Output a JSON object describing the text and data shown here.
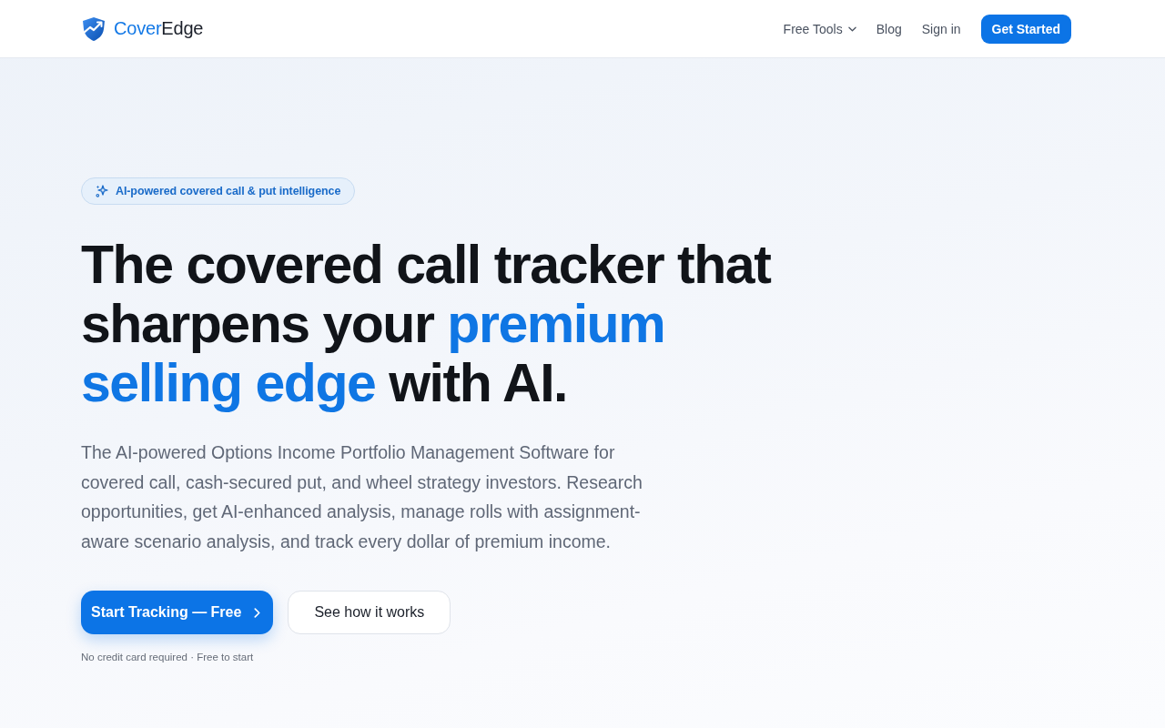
{
  "header": {
    "logo": [
      {
        "text": "Cover",
        "highlight": true
      },
      {
        "text": "Edge",
        "highlight": false
      }
    ],
    "nav": [
      {
        "kind": "dropdown",
        "label": "Free Tools"
      },
      {
        "kind": "link",
        "label": "Blog"
      },
      {
        "kind": "link",
        "label": "Sign in"
      },
      {
        "kind": "button",
        "label": "Get Started"
      }
    ]
  },
  "hero": {
    "badge": "AI-powered covered call & put intelligence",
    "headline": [
      {
        "text": "The covered call tracker that sharpens your ",
        "highlight": false
      },
      {
        "text": "premium selling edge",
        "highlight": true
      },
      {
        "text": " with AI.",
        "highlight": false
      }
    ],
    "description": "The AI-powered Options Income Portfolio Management Software for covered call, cash-secured put, and wheel strategy investors. Research opportunities, get AI-enhanced analysis, manage rolls with assignment-aware scenario analysis, and track every dollar of premium income.",
    "buttons": [
      {
        "kind": "primary",
        "label": "Start Tracking — Free"
      },
      {
        "kind": "secondary",
        "label": "See how it works"
      }
    ],
    "note": "No credit card required · Free to start"
  }
}
